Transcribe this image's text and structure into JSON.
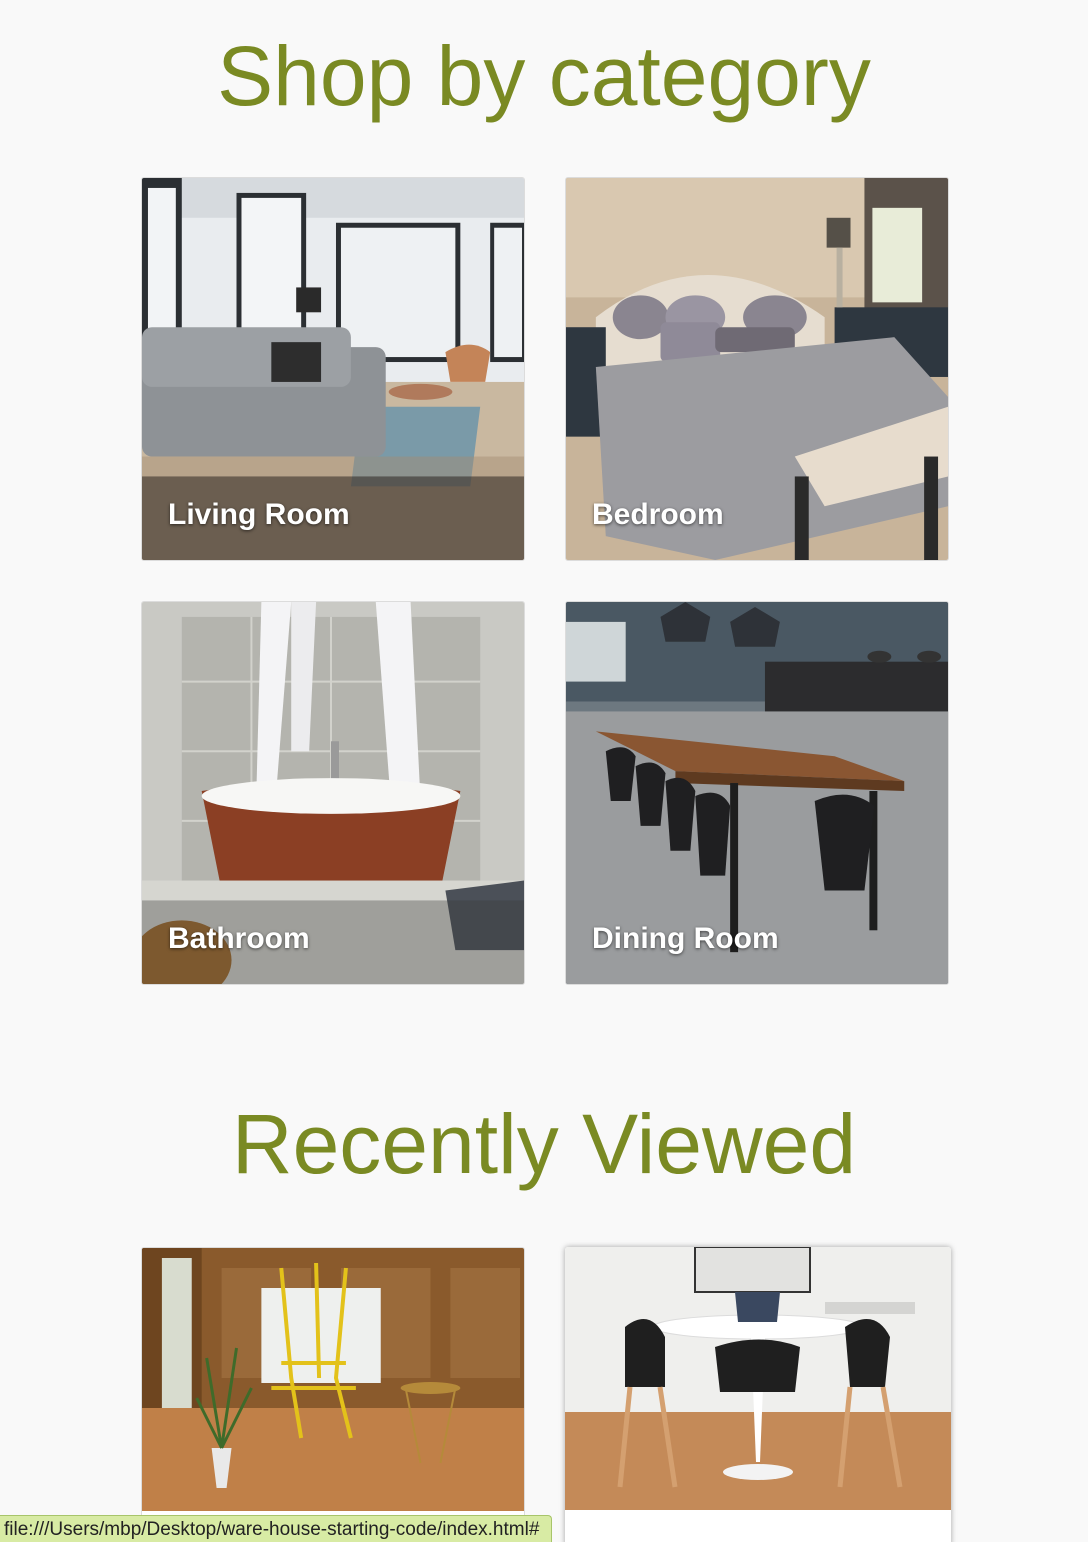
{
  "sections": {
    "category_title": "Shop by category",
    "recent_title": "Recently Viewed"
  },
  "categories": [
    {
      "label": "Living Room"
    },
    {
      "label": "Bedroom"
    },
    {
      "label": "Bathroom"
    },
    {
      "label": "Dining Room"
    }
  ],
  "status_bar": {
    "url": "file:///Users/mbp/Desktop/ware-house-starting-code/index.html#"
  },
  "colors": {
    "heading": "#7a8a23",
    "background": "#f9f9f9",
    "status_bar": "#d8eba4"
  }
}
